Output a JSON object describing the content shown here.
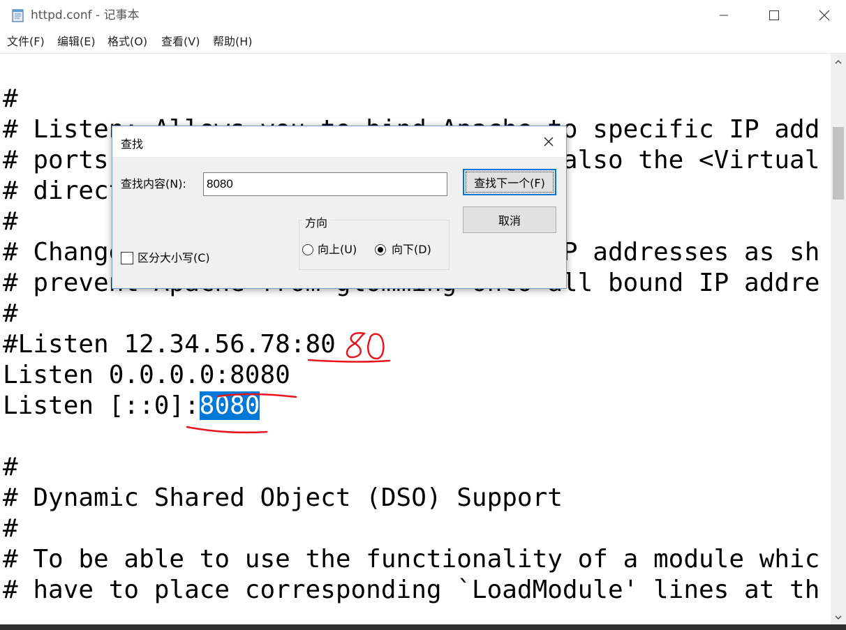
{
  "window": {
    "title": "httpd.conf - 记事本"
  },
  "menu": {
    "items": [
      "文件(F)",
      "编辑(E)",
      "格式(O)",
      "查看(V)",
      "帮助(H)"
    ]
  },
  "editor": {
    "lines": [
      {
        "text": "#"
      },
      {
        "text": "# Listen: Allows you to bind Apache to specific IP add"
      },
      {
        "text": "# ports, instead of the default. See also the <Virtual"
      },
      {
        "text": "# directive."
      },
      {
        "text": "#"
      },
      {
        "text": "# Change this to Listen on specific IP addresses as sh"
      },
      {
        "text": "# prevent Apache from glomming onto all bound IP addre"
      },
      {
        "text": "#"
      },
      {
        "text": "#Listen 12.34.56.78:80"
      },
      {
        "text": "Listen 0.0.0.0:8080"
      },
      {
        "text": "Listen [::0]:",
        "selected": "8080"
      },
      {
        "text": ""
      },
      {
        "text": "#"
      },
      {
        "text": "# Dynamic Shared Object (DSO) Support"
      },
      {
        "text": "#"
      },
      {
        "text": "# To be able to use the functionality of a module whic"
      },
      {
        "text": "# have to place corresponding `LoadModule' lines at th"
      }
    ]
  },
  "annotations": {
    "handwritten_text": "80",
    "ink_color": "#e8141e"
  },
  "find_dialog": {
    "title": "查找",
    "find_label": "查找内容(N):",
    "find_value": "8080",
    "find_next_label": "查找下一个(F)",
    "cancel_label": "取消",
    "direction_label": "方向",
    "up_label": "向上(U)",
    "down_label": "向下(D)",
    "direction_selected": "down",
    "match_case_label": "区分大小写(C)",
    "match_case_checked": false
  }
}
